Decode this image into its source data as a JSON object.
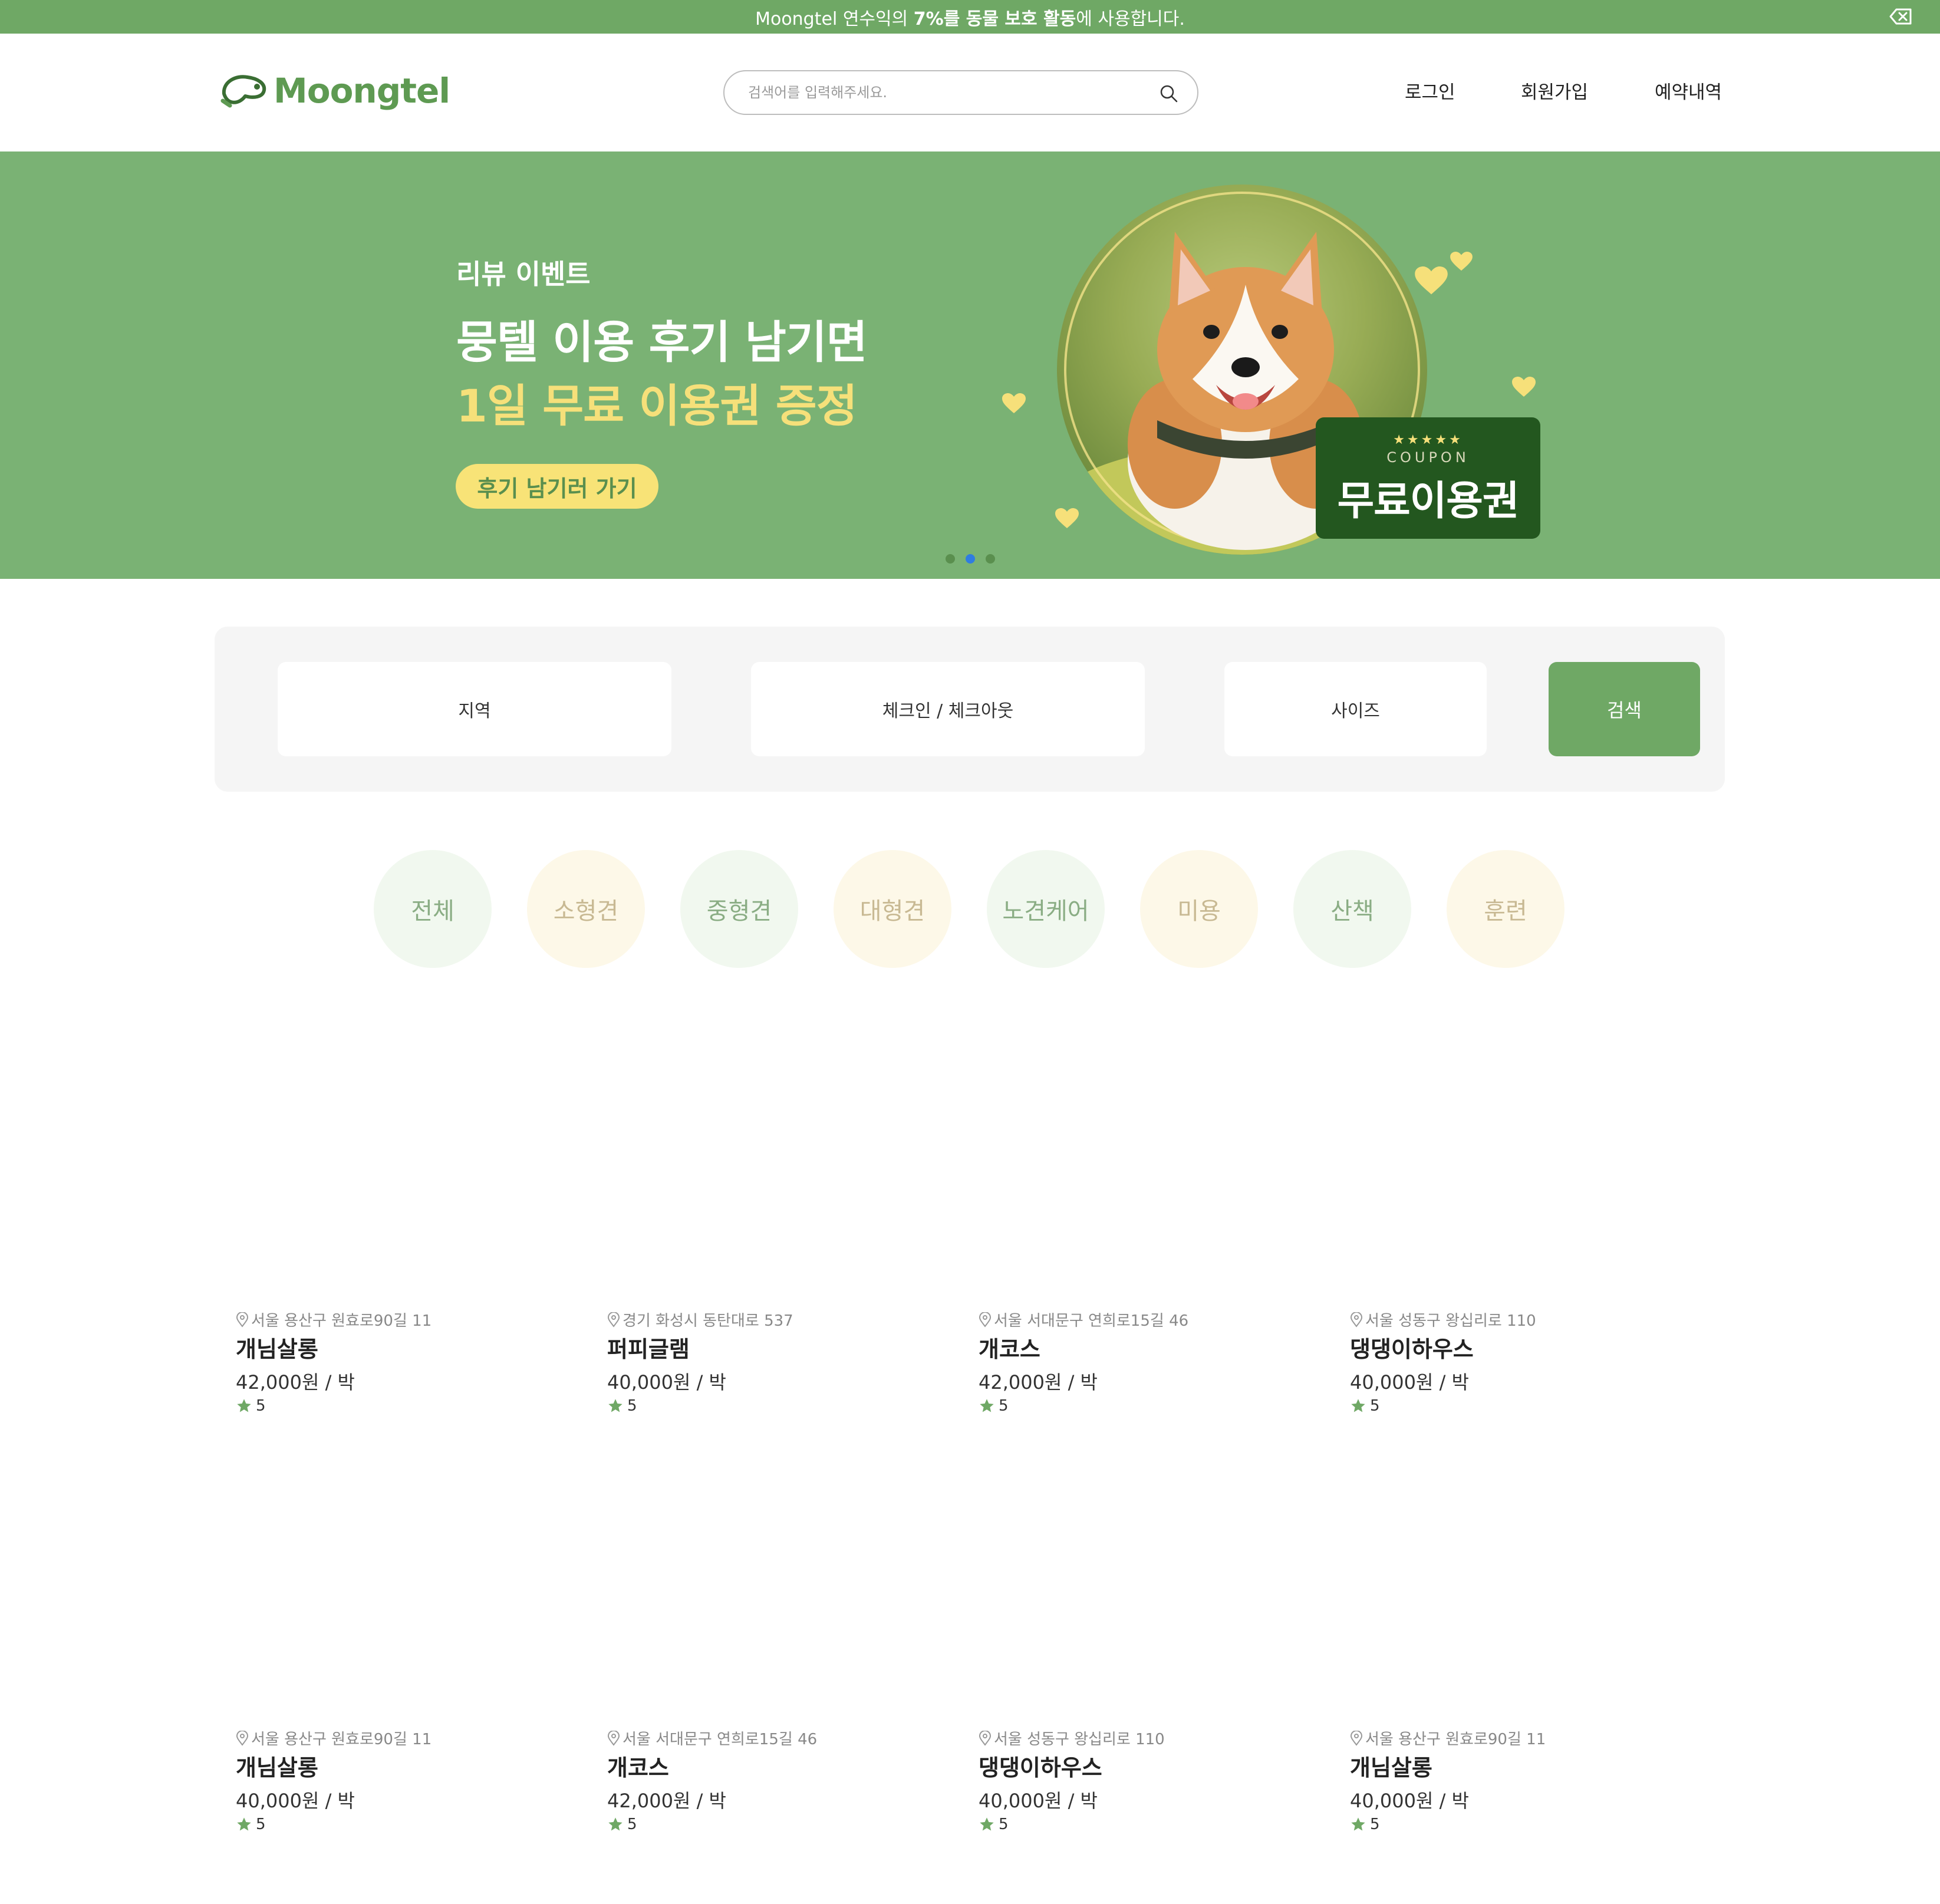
{
  "topbar": {
    "message_pre": "Moongtel 연수익의 ",
    "message_bold1": "7%를 동물 보호 활동",
    "message_post": "에 사용합니다."
  },
  "header": {
    "logo_text": "Moongtel",
    "search_placeholder": "검색어를 입력해주세요.",
    "nav": [
      "로그인",
      "회원가입",
      "예약내역"
    ]
  },
  "banner": {
    "eyebrow": "리뷰 이벤트",
    "headline1": "뭉텔 이용 후기 남기면",
    "headline2": "1일 무료 이용권 증정",
    "button_label": "후기 남기러 가기",
    "coupon_stars": "★★★★★",
    "coupon_label": "COUPON",
    "coupon_title": "무료이용권",
    "active_slide": 2,
    "slide_count": 3
  },
  "filter": {
    "region": "지역",
    "dates": "체크인 / 체크아웃",
    "size": "사이즈",
    "search_button": "검색"
  },
  "categories": [
    "전체",
    "소형견",
    "중형견",
    "대형견",
    "노견케어",
    "미용",
    "산책",
    "훈련"
  ],
  "listings": [
    {
      "address": "서울 용산구 원효로90길 11",
      "name": "개님살롱",
      "price": "42,000원 / 박",
      "rating": "5"
    },
    {
      "address": "경기 화성시 동탄대로 537",
      "name": "퍼피글램",
      "price": "40,000원 / 박",
      "rating": "5"
    },
    {
      "address": "서울 서대문구 연희로15길 46",
      "name": "개코스",
      "price": "42,000원 / 박",
      "rating": "5"
    },
    {
      "address": "서울 성동구 왕십리로 110",
      "name": "댕댕이하우스",
      "price": "40,000원 / 박",
      "rating": "5"
    },
    {
      "address": "서울 용산구 원효로90길 11",
      "name": "개님살롱",
      "price": "40,000원 / 박",
      "rating": "5"
    },
    {
      "address": "서울 서대문구 연희로15길 46",
      "name": "개코스",
      "price": "42,000원 / 박",
      "rating": "5"
    },
    {
      "address": "서울 성동구 왕십리로 110",
      "name": "댕댕이하우스",
      "price": "40,000원 / 박",
      "rating": "5"
    },
    {
      "address": "서울 용산구 원효로90길 11",
      "name": "개님살롱",
      "price": "40,000원 / 박",
      "rating": "5"
    }
  ],
  "colors": {
    "brand_green": "#6fa865",
    "banner_green": "#7ab274",
    "accent_yellow": "#f8e377",
    "coupon_green": "#23571f"
  },
  "icons": {
    "close": "close-tag-icon",
    "search": "search-icon",
    "pin": "location-pin-icon",
    "star": "star-icon",
    "logo": "dog-logo-icon"
  }
}
